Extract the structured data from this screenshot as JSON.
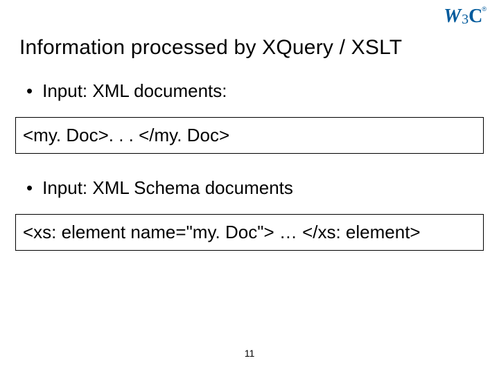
{
  "logo": {
    "w": "W",
    "three": "3",
    "c": "C",
    "reg": "®"
  },
  "title": "Information processed by XQuery / XSLT",
  "bullets": {
    "dot": "•",
    "item1": "Input: XML documents:",
    "item2": "Input: XML Schema documents"
  },
  "code": {
    "box1": "<my. Doc>. . . </my. Doc>",
    "box2": "<xs: element name=\"my. Doc\"> … </xs: element>"
  },
  "page_number": "11"
}
